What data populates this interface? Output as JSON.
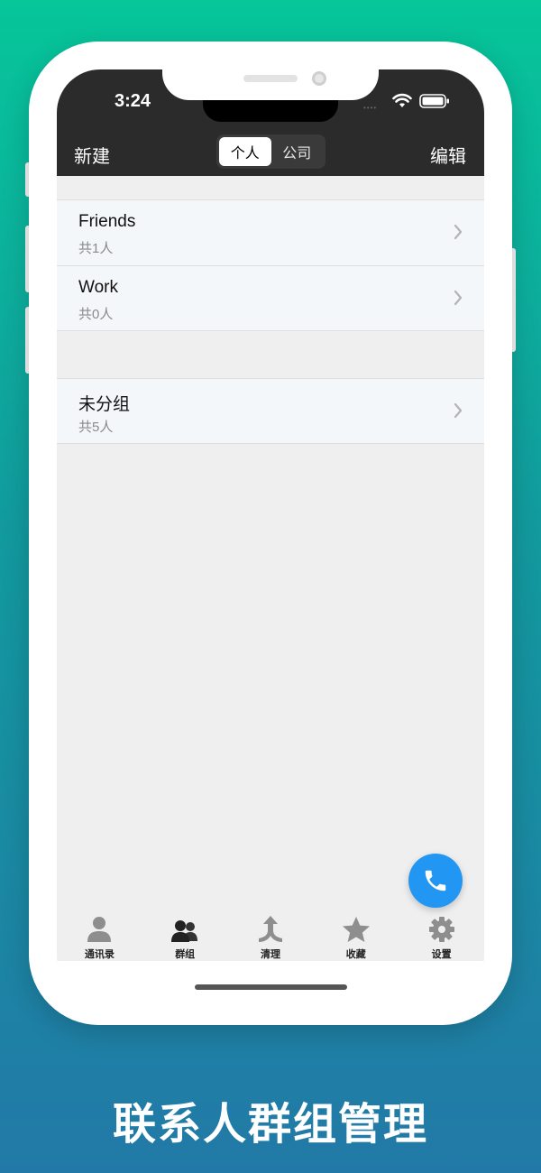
{
  "status_bar": {
    "time": "3:24",
    "signal_dots": "••••"
  },
  "nav": {
    "new_label": "新建",
    "edit_label": "编辑",
    "segments": [
      {
        "label": "个人",
        "selected": true
      },
      {
        "label": "公司",
        "selected": false
      }
    ]
  },
  "groups": [
    {
      "name": "Friends",
      "count": "共1人"
    },
    {
      "name": "Work",
      "count": "共0人"
    }
  ],
  "ungrouped": {
    "name": "未分组",
    "count": "共5人"
  },
  "tabs": [
    {
      "label": "通讯录",
      "icon": "person-icon"
    },
    {
      "label": "群组",
      "icon": "group-icon"
    },
    {
      "label": "清理",
      "icon": "merge-icon"
    },
    {
      "label": "收藏",
      "icon": "star-icon"
    },
    {
      "label": "设置",
      "icon": "gear-icon"
    }
  ],
  "caption": "联系人群组管理",
  "colors": {
    "fab": "#2196f3",
    "topbar": "#2b2b2b",
    "background_top": "#06c69a",
    "background_bottom": "#2279a7"
  }
}
